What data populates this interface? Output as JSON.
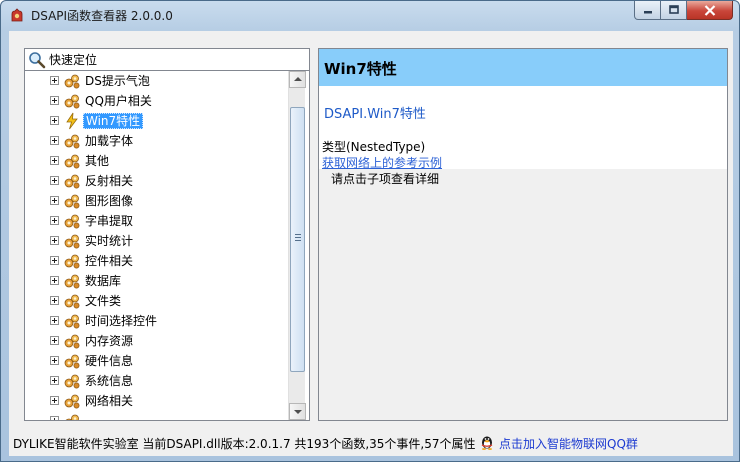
{
  "window": {
    "title": "DSAPI函数查看器 2.0.0.0"
  },
  "search": {
    "placeholder": "快速定位",
    "value": ""
  },
  "tree": {
    "items": [
      {
        "label": "DS提示气泡",
        "selected": false,
        "icon": "gears-icon"
      },
      {
        "label": "QQ用户相关",
        "selected": false,
        "icon": "gears-icon"
      },
      {
        "label": "Win7特性",
        "selected": true,
        "icon": "lightning-icon"
      },
      {
        "label": "加载字体",
        "selected": false,
        "icon": "gears-icon"
      },
      {
        "label": "其他",
        "selected": false,
        "icon": "gears-icon"
      },
      {
        "label": "反射相关",
        "selected": false,
        "icon": "gears-icon"
      },
      {
        "label": "图形图像",
        "selected": false,
        "icon": "gears-icon"
      },
      {
        "label": "字串提取",
        "selected": false,
        "icon": "gears-icon"
      },
      {
        "label": "实时统计",
        "selected": false,
        "icon": "gears-icon"
      },
      {
        "label": "控件相关",
        "selected": false,
        "icon": "gears-icon"
      },
      {
        "label": "数据库",
        "selected": false,
        "icon": "gears-icon"
      },
      {
        "label": "文件类",
        "selected": false,
        "icon": "gears-icon"
      },
      {
        "label": "时间选择控件",
        "selected": false,
        "icon": "gears-icon"
      },
      {
        "label": "内存资源",
        "selected": false,
        "icon": "gears-icon"
      },
      {
        "label": "硬件信息",
        "selected": false,
        "icon": "gears-icon"
      },
      {
        "label": "系统信息",
        "selected": false,
        "icon": "gears-icon"
      },
      {
        "label": "网络相关",
        "selected": false,
        "icon": "gears-icon"
      },
      {
        "label": "",
        "selected": false,
        "icon": "gears-icon"
      }
    ]
  },
  "detail": {
    "title": "Win7特性",
    "qualified_name": "DSAPI.Win7特性",
    "type_line": "类型(NestedType)",
    "ref_link": "获取网络上的参考示例",
    "hint": "请点击子项查看详细"
  },
  "status": {
    "text": "DYLIKE智能软件实验室   当前DSAPI.dll版本:2.0.1.7 共193个函数,35个事件,57个属性",
    "qq_link": "点击加入智能物联网QQ群"
  },
  "colors": {
    "header_bg": "#88cdfa",
    "selection": "#3399ff",
    "link": "#2d62d6"
  }
}
